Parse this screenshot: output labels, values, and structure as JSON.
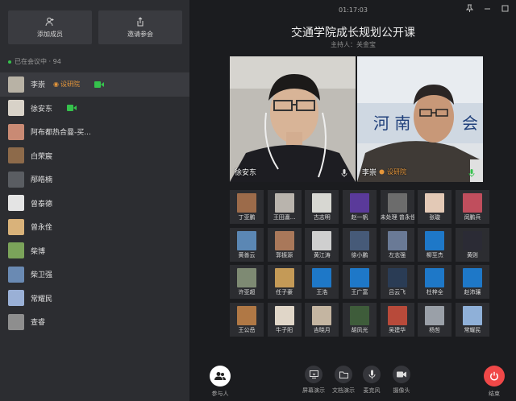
{
  "sidebar": {
    "add_member_label": "添加成员",
    "invite_label": "邀请参会",
    "status_text": "已在会议中 · 94",
    "participants": [
      {
        "name": "李崇",
        "tag": "设研院",
        "video": true,
        "color": "#b8b2a5",
        "active": true
      },
      {
        "name": "徐安东",
        "tag": "",
        "video": true,
        "color": "#d8d2c8"
      },
      {
        "name": "阿布都热合曼-买...",
        "tag": "",
        "video": false,
        "color": "#c98a74"
      },
      {
        "name": "白荣宸",
        "tag": "",
        "video": false,
        "color": "#8d6a4a"
      },
      {
        "name": "邴皓楠",
        "tag": "",
        "video": false,
        "color": "#5a5d62"
      },
      {
        "name": "曾泰德",
        "tag": "",
        "video": false,
        "color": "#e4e4e4"
      },
      {
        "name": "曾永佺",
        "tag": "",
        "video": false,
        "color": "#d9b27a"
      },
      {
        "name": "柴博",
        "tag": "",
        "video": false,
        "color": "#7ba35a"
      },
      {
        "name": "柴卫强",
        "tag": "",
        "video": false,
        "color": "#6a8ab3"
      },
      {
        "name": "常耀民",
        "tag": "",
        "video": false,
        "color": "#9ab0d6"
      },
      {
        "name": "查睿",
        "tag": "",
        "video": false,
        "color": "#8e8e8e"
      }
    ]
  },
  "main": {
    "timer": "01:17:03",
    "title": "交通学院成长规划公开课",
    "host": "主持人：关金宝",
    "video_left_name": "徐安东",
    "video_right_name": "李崇",
    "video_right_tag": "设研院",
    "grid": [
      {
        "name": "丁亚鹏",
        "color": "#9c6b4a"
      },
      {
        "name": "王田瀛...",
        "color": "#b9b4ad"
      },
      {
        "name": "古志明",
        "color": "#d7d7d2"
      },
      {
        "name": "赵一帆",
        "color": "#5a3a9a"
      },
      {
        "name": "未处理 曾永佺",
        "color": "#6c6c6c"
      },
      {
        "name": "张璇",
        "color": "#e3c9b6"
      },
      {
        "name": "闵鹏兵",
        "color": "#c04e5d"
      },
      {
        "name": "黄善云",
        "color": "#5b87b4"
      },
      {
        "name": "郭振源",
        "color": "#a9785a"
      },
      {
        "name": "黄江涛",
        "color": "#cfcfcf"
      },
      {
        "name": "徐小鹏",
        "color": "#465a78"
      },
      {
        "name": "左志强",
        "color": "#6a7a96"
      },
      {
        "name": "柳至杰",
        "color": "#1e78c8"
      },
      {
        "name": "黄则",
        "color": "#2b2b35"
      },
      {
        "name": "许亚超",
        "color": "#7e8a73"
      },
      {
        "name": "任子豪",
        "color": "#c49a57"
      },
      {
        "name": "王浩",
        "color": "#1e78c8"
      },
      {
        "name": "王广富",
        "color": "#1e78c8"
      },
      {
        "name": "吕云飞",
        "color": "#2a3c55"
      },
      {
        "name": "杜梓全",
        "color": "#1e78c8"
      },
      {
        "name": "赵沛骧",
        "color": "#1e78c8"
      },
      {
        "name": "王公岳",
        "color": "#b07845"
      },
      {
        "name": "牛子阳",
        "color": "#e0d6c8"
      },
      {
        "name": "吉晓月",
        "color": "#c4b5a1"
      },
      {
        "name": "胡凤光",
        "color": "#3e5c3a"
      },
      {
        "name": "吴建华",
        "color": "#b84a3a"
      },
      {
        "name": "杨哲",
        "color": "#9aa0a8"
      },
      {
        "name": "常耀民",
        "color": "#8fb0d8"
      }
    ]
  },
  "toolbar": {
    "participants_label": "参与人",
    "screen_share_label": "屏幕演示",
    "doc_label": "文档演示",
    "mic_label": "麦克风",
    "camera_label": "摄像头",
    "end_label": "结束"
  }
}
